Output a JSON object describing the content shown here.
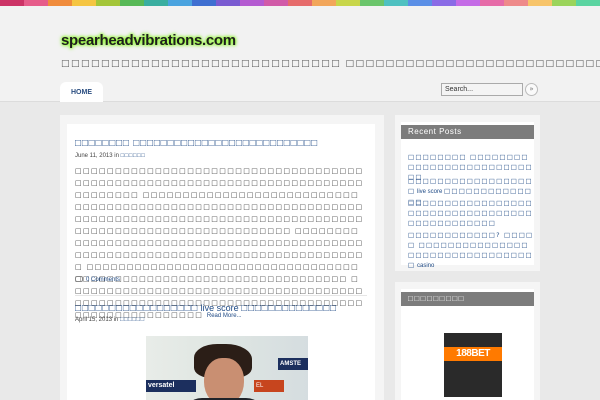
{
  "site": {
    "logo": "spearheadvibrations.com",
    "tagline": "□□□□□□□□□□□□□□□□□□□□□□□□□□□□ □□□□□□□□□□□□□□□□□□□□□□□□□□"
  },
  "colors": {
    "stripe": [
      "#cc3366",
      "#e65c8a",
      "#f08c3c",
      "#f5c542",
      "#a4c639",
      "#58b957",
      "#3aaea0",
      "#4aa3df",
      "#3f6fd1",
      "#7a5bd1",
      "#b45bd1",
      "#d15ba8",
      "#e66b6b",
      "#f2a65a",
      "#c8d64a",
      "#6bc56b",
      "#4fc1c1",
      "#5b8fe6",
      "#8a6be6",
      "#c46be6",
      "#e66ba8",
      "#ee8a8a",
      "#f7c46a",
      "#9bd45b",
      "#5bd4a1"
    ]
  },
  "nav": {
    "home": "HOME"
  },
  "search": {
    "placeholder": "Search...",
    "button_icon": "arrow-right-icon"
  },
  "posts": [
    {
      "title": "□□□□□□□□ □□□□□□□□□□□□□□□□□□□□□□□□□□□",
      "date": "June 11, 2013 in",
      "category": "□□□□□□",
      "excerpt": "□□□□□□□□□□□□□□□□□□□□□□□□□□□□□□□□□□□□□□□□□□□□□□□□□□□□□□□□□□□□□□□□□□□□□□□□□□□□□□□□ □□□□□□□□□□□□□□□□□□□□□□□□□□□□□□□□□□□□□□□□□□□□□□□□□□□□□□□□□□□□□□□□□□□□□□□□□□□□□□□□□□□□□□□□□□□□□□□□□□□□□□□□□□□□□□□□□□□□□□□□□□□□□□ □□□□□□□□□□□□□□□□□□□□□□□□□□□□□□□□□□□□□□□□□□□□□□□□□□□□□□□□□□□□□□□□□□□□□□□□□□□□□□□□□ □□□□□□□□□□□□□□□□□□□□□□□□□□□□□□□□□□□□□□□□□□□□□□□□□□□□□□□□□□□□□□□□□□□□ □□□□□□□□□□□□□□□□□□□□□□□□□□□□□□□□□□□□□□□□□□□□□□□□□□□□□□□□□□□□□□□□□□□□□□□□□□□□□□□□□□□□□□□□□ ",
      "read_more": "Read More...",
      "comments": "0 Comments"
    },
    {
      "title_part1": "□□□□□□□□□□□□□□□□□□",
      "title_part2": " live score ",
      "title_part3": "□□□□□□□□□□□□□□",
      "date": "April 15, 2013 in",
      "category": "□□□□□□",
      "image_labels": [
        "versatel",
        "AMSTE",
        "EL"
      ]
    }
  ],
  "sidebar": {
    "recent_title": "Recent Posts",
    "recent": [
      {
        "text": "□□□□□□□□ □□□□□□□□□□□□□□□□□□□□□□□□□□□"
      },
      {
        "text": "□□□□□□□□□□□□□□□□□□",
        "latin": " live score ",
        "text2": "□□□□□□□□□□□□□□"
      },
      {
        "text": "□□□□□□□□□□□□□□□□□□□□□□□□□□□□□□□□□□□□□□□□□□□□□□"
      },
      {
        "text": "□□□□□□□□□□□□? □□□□□ □□□□□□□□□□□□□□□□□□□□□□□□□□□□□□□□□",
        "latin": " casino"
      }
    ],
    "widget2_title": "□□□□□□□□□",
    "banner": "188BET"
  }
}
